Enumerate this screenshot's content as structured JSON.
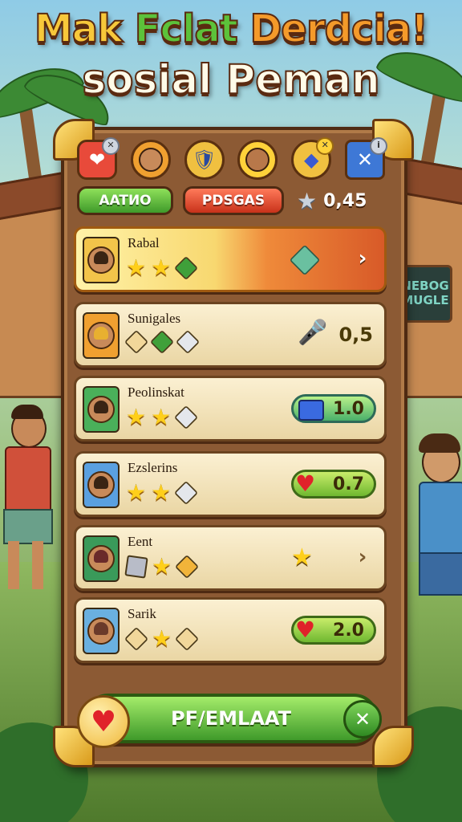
{
  "title": {
    "line1_a": "Mak ",
    "line1_b": "Fclat",
    "line1_c": " Derdcia!",
    "line2": "sosial Peman"
  },
  "top_icons": [
    {
      "icon": "heart-card-icon",
      "glyph": "❤"
    },
    {
      "icon": "player-avatar-icon",
      "glyph": ""
    },
    {
      "icon": "shield-icon",
      "glyph": "🛡"
    },
    {
      "icon": "crowned-avatar-icon",
      "glyph": ""
    },
    {
      "icon": "gem-icon",
      "glyph": "◆"
    },
    {
      "icon": "close-square-icon",
      "glyph": "✕"
    }
  ],
  "tabs": {
    "active": "AATИO",
    "other": "PDSGAS"
  },
  "score": "0,45",
  "rows": [
    {
      "name": "Rabal",
      "value": "",
      "avatar_bg": "#f2c44a"
    },
    {
      "name": "Sunigales",
      "value": "0,5",
      "avatar_bg": "#f0a030"
    },
    {
      "name": "Peolinskat",
      "value": "1.0",
      "avatar_bg": "#4ab05a"
    },
    {
      "name": "Ezslerins",
      "value": "0.7",
      "avatar_bg": "#5aa0e0"
    },
    {
      "name": "Eent",
      "value": "",
      "avatar_bg": "#3a9a5a"
    },
    {
      "name": "Sarik",
      "value": "2.0",
      "avatar_bg": "#6ab0e0"
    }
  ],
  "button": {
    "label": "PF/EMLAAT"
  },
  "colors": {
    "accent_green": "#3f9a2a",
    "accent_red": "#c8321a",
    "gold": "#ffcf1a",
    "wood": "#8c5a34"
  },
  "sign": {
    "line1": "NEBOG",
    "line2": "MUGLE"
  }
}
